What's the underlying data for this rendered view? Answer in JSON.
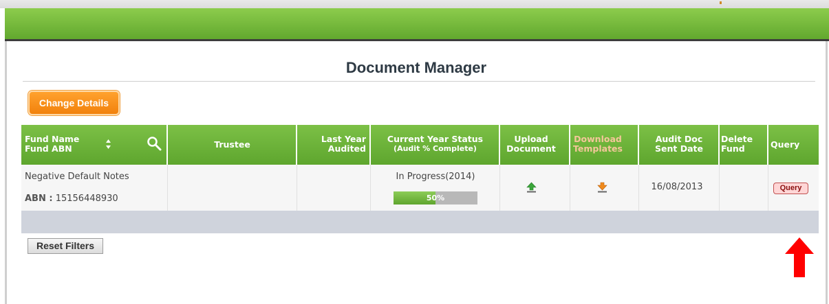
{
  "page": {
    "title": "Document Manager"
  },
  "actions": {
    "change_details": "Change Details",
    "reset_filters": "Reset Filters"
  },
  "table": {
    "headers": {
      "fund_name": "Fund Name",
      "fund_abn": "Fund ABN",
      "trustee": "Trustee",
      "last_year_1": "Last Year",
      "last_year_2": "Audited",
      "current_status": "Current Year Status",
      "current_status_sub": "(Audit % Complete)",
      "upload_1": "Upload",
      "upload_2": "Document",
      "download_1": "Download",
      "download_2": "Templates",
      "audit_1": "Audit Doc",
      "audit_2": "Sent Date",
      "delete_1": "Delete",
      "delete_2": "Fund",
      "query": "Query"
    },
    "rows": [
      {
        "fund_name": "Negative Default Notes",
        "abn_label": "ABN :",
        "abn": "15156448930",
        "trustee": "",
        "last_year_audited": "",
        "status": "In Progress(2014)",
        "progress_percent": 50,
        "progress_label": "50%",
        "audit_doc_sent_date": "16/08/2013",
        "query_label": "Query"
      }
    ]
  },
  "colors": {
    "header_green": "#6db43c",
    "orange": "#f7901e",
    "progress_grey": "#b8b8b8",
    "annotation_red": "#ff0000"
  },
  "icons": {
    "sort": "sort-arrows-icon",
    "search": "search-icon",
    "upload": "upload-arrow-icon",
    "download": "download-arrow-icon",
    "annotation": "red-up-arrow-icon"
  }
}
